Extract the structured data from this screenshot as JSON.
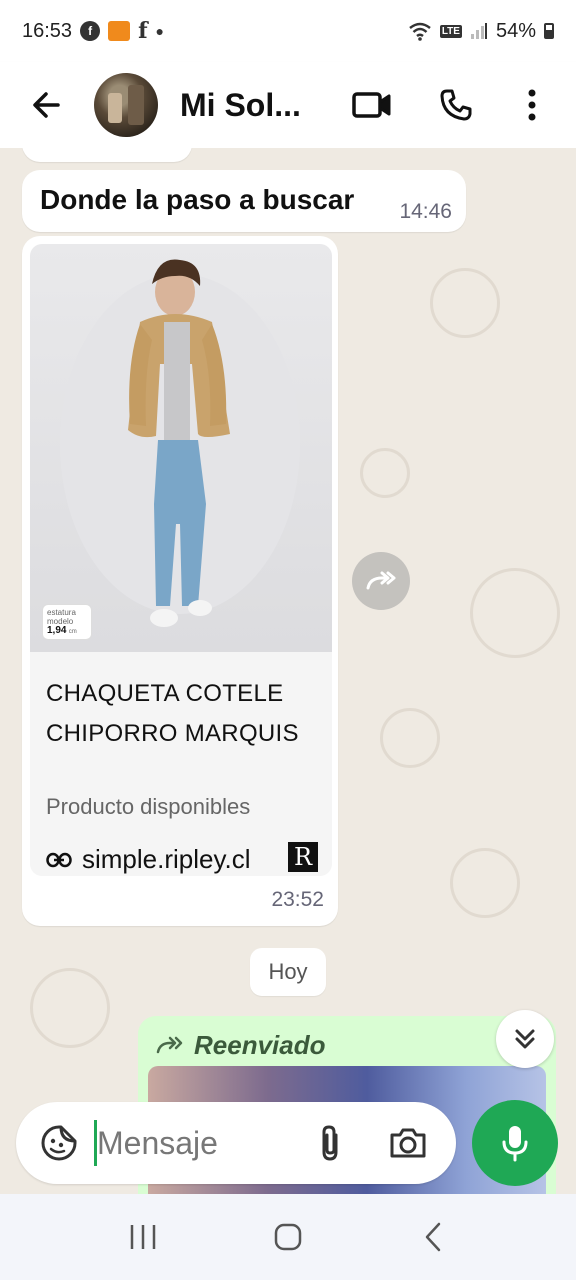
{
  "status_bar": {
    "time": "16:53",
    "notif_app_label": "",
    "letter_icon": "f",
    "network": "LTE",
    "battery": "54%"
  },
  "header": {
    "contact_name": "Mi Sol...",
    "icons": [
      "back-arrow-icon",
      "video-call-icon",
      "phone-icon",
      "more-vert-icon"
    ]
  },
  "messages": [
    {
      "type": "incoming-text",
      "text": "Donde la paso a buscar",
      "time": "14:46"
    },
    {
      "type": "incoming-link",
      "image_badge_line1": "estatura",
      "image_badge_line2": "modelo",
      "image_badge_value": "1,94",
      "image_badge_unit": "cm",
      "title": "CHAQUETA COTELE CHIPORRO MARQUIS",
      "description": "Producto disponibles",
      "link": "simple.ripley.cl",
      "brand_logo": "R",
      "time": "23:52"
    }
  ],
  "date_chip": "Hoy",
  "forwarded": {
    "label": "Reenviado"
  },
  "composer": {
    "placeholder": "Mensaje"
  },
  "colors": {
    "accent": "#1fa855",
    "outgoing_bubble": "#d9fdd3",
    "chat_bg": "#efeae2"
  }
}
